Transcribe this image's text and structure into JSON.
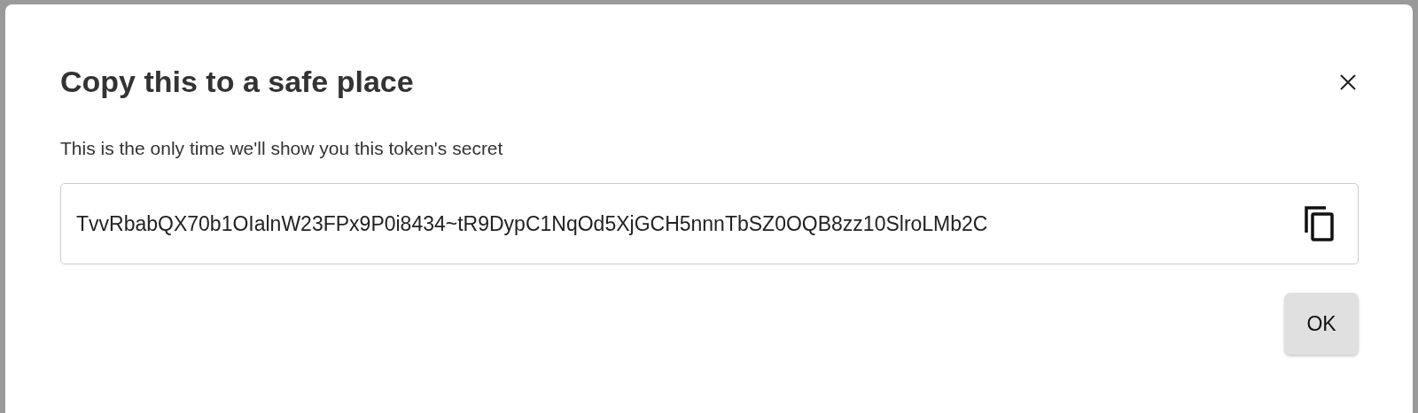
{
  "dialog": {
    "title": "Copy this to a safe place",
    "message": "This is the only time we'll show you this token's secret",
    "token": "TvvRbabQX70b1OIalnW23FPx9P0i8434~tR9DypC1NqOd5XjGCH5nnnTbSZ0OQB8zz10SlroLMb2C",
    "buttons": [
      "OK"
    ]
  }
}
